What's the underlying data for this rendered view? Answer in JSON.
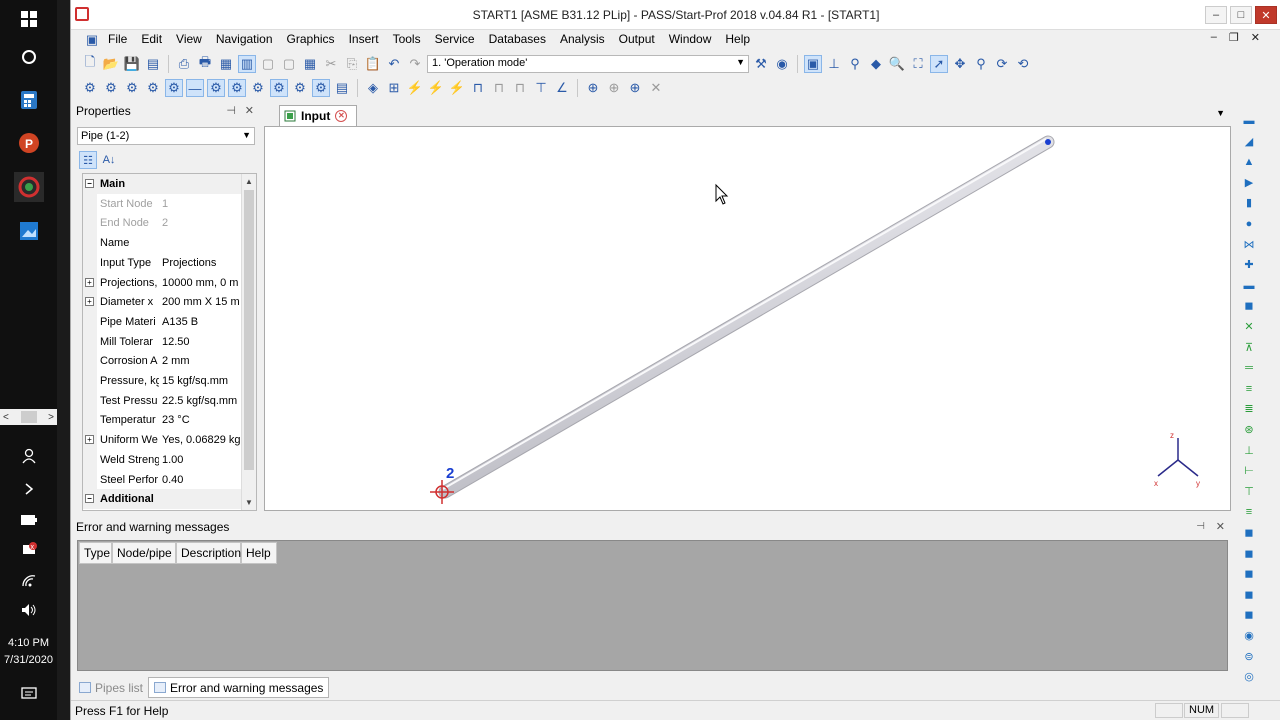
{
  "taskbar": {
    "clock_time": "4:10 PM",
    "clock_date": "7/31/2020",
    "scroll_left": "<",
    "scroll_right": ">"
  },
  "window": {
    "title": "START1 [ASME B31.12 PLip] - PASS/Start-Prof 2018 v.04.84 R1 - [START1]",
    "minimize": "–",
    "maximize": "□",
    "close": "✕"
  },
  "menu": [
    "File",
    "Edit",
    "View",
    "Navigation",
    "Graphics",
    "Insert",
    "Tools",
    "Service",
    "Databases",
    "Analysis",
    "Output",
    "Window",
    "Help"
  ],
  "toolbar": {
    "mode_value": "1. 'Operation mode'"
  },
  "properties": {
    "title": "Properties",
    "object_value": "Pipe (1-2)",
    "rows": [
      {
        "name": "Main",
        "value": "",
        "kind": "category",
        "exp": "−"
      },
      {
        "name": "Start Node",
        "value": "1",
        "kind": "disabled",
        "exp": ""
      },
      {
        "name": "End Node",
        "value": "2",
        "kind": "disabled",
        "exp": ""
      },
      {
        "name": "Name",
        "value": "",
        "kind": "normal",
        "exp": ""
      },
      {
        "name": "Input Type",
        "value": "Projections",
        "kind": "normal",
        "exp": ""
      },
      {
        "name": "Projections,",
        "value": "10000 mm, 0 m",
        "kind": "normal",
        "exp": "+"
      },
      {
        "name": "Diameter x",
        "value": "200 mm X 15 m",
        "kind": "normal",
        "exp": "+"
      },
      {
        "name": "Pipe Materi",
        "value": "A135 B",
        "kind": "normal",
        "exp": ""
      },
      {
        "name": "Mill Tolerar",
        "value": "12.50",
        "kind": "normal",
        "exp": ""
      },
      {
        "name": "Corrosion A",
        "value": "2 mm",
        "kind": "normal",
        "exp": ""
      },
      {
        "name": "Pressure, kg",
        "value": "15 kgf/sq.mm",
        "kind": "normal",
        "exp": ""
      },
      {
        "name": "Test Pressu",
        "value": "22.5 kgf/sq.mm",
        "kind": "normal",
        "exp": ""
      },
      {
        "name": "Temperatur",
        "value": "23 °C",
        "kind": "normal",
        "exp": ""
      },
      {
        "name": "Uniform We",
        "value": "Yes, 0.06829 kg",
        "kind": "normal",
        "exp": "+"
      },
      {
        "name": "Weld Streng",
        "value": "1.00",
        "kind": "normal",
        "exp": ""
      },
      {
        "name": "Steel Perfor",
        "value": "0.40",
        "kind": "normal",
        "exp": ""
      },
      {
        "name": "Additional",
        "value": "",
        "kind": "category",
        "exp": "−"
      }
    ]
  },
  "document": {
    "tab_label": "Input",
    "node_label": "2",
    "axes": {
      "z": "z",
      "x": "x",
      "y": "y"
    }
  },
  "errors": {
    "title": "Error and warning messages",
    "columns": [
      "Type",
      "Node/pipe",
      "Description",
      "Help"
    ]
  },
  "bottom_tabs": [
    {
      "label": "Pipes list",
      "active": false
    },
    {
      "label": "Error and warning messages",
      "active": true
    }
  ],
  "status": {
    "text": "Press F1 for Help",
    "num": "NUM"
  }
}
